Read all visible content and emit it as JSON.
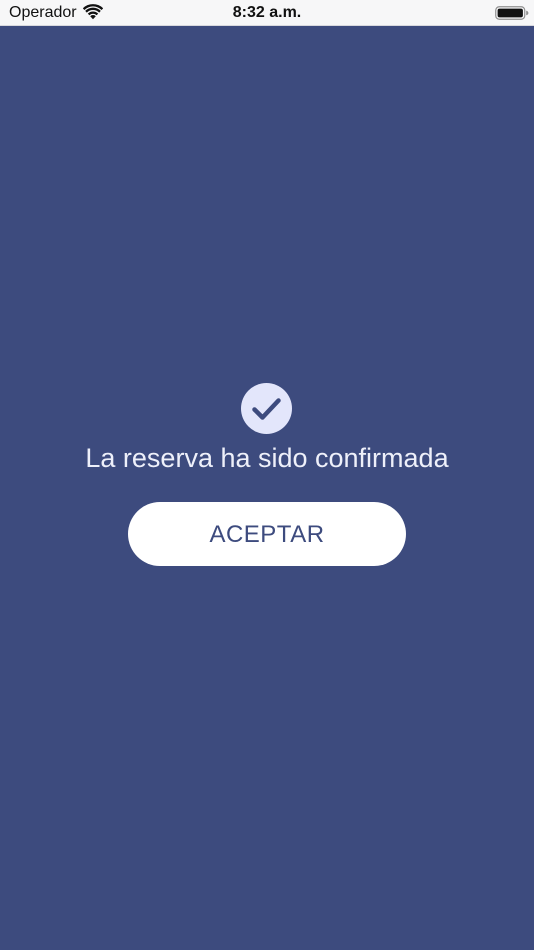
{
  "status_bar": {
    "carrier": "Operador",
    "time": "8:32 a.m.",
    "wifi_icon": "wifi-icon",
    "battery_icon": "battery-full-icon"
  },
  "confirmation": {
    "icon": "checkmark-circle-icon",
    "message": "La reserva ha sido confirmada",
    "accept_label": "ACEPTAR"
  },
  "colors": {
    "background": "#3d4b7e",
    "icon_circle": "#e3e6fb",
    "button_bg": "#ffffff",
    "button_text": "#3d4b7e"
  }
}
